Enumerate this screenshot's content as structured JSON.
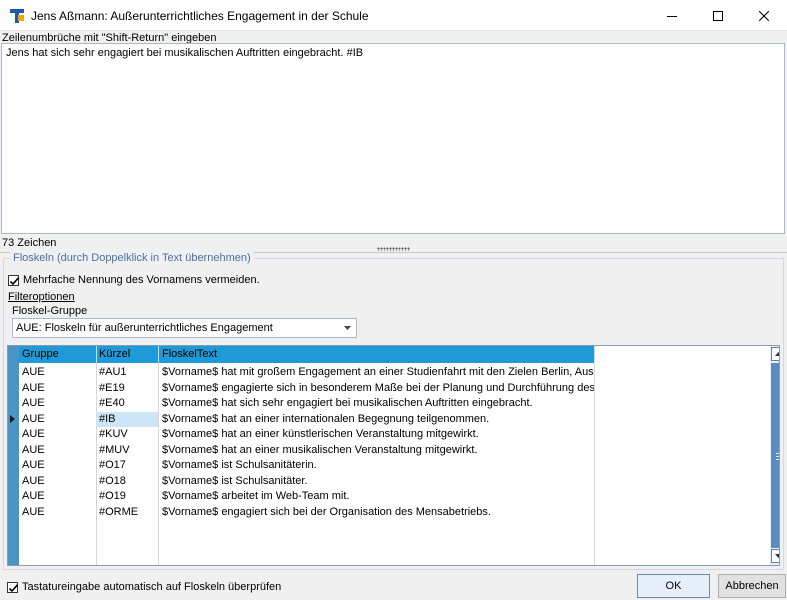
{
  "window": {
    "title": "Jens Aßmann: Außerunterrichtliches Engagement in der Schule",
    "controls": [
      "minimize-icon",
      "maximize-icon",
      "close-icon"
    ]
  },
  "editor": {
    "hint": "Zeilenumbrüche mit \"Shift-Return\" eingeben",
    "text": "Jens hat sich sehr engagiert bei musikalischen Auftritten eingebracht.  #IB",
    "char_count": "73 Zeichen"
  },
  "floskeln": {
    "group_title": "Floskeln (durch Doppelklick in Text übernehmen)",
    "avoid_repeat_label": "Mehrfache Nennung des Vornamens vermeiden.",
    "avoid_repeat_checked": true,
    "filter_link": "Filteroptionen",
    "group_select_label": "Floskel-Gruppe",
    "group_select_value": "AUE: Floskeln für außerunterrichtliches Engagement"
  },
  "grid": {
    "columns": [
      "Gruppe",
      "Kürzel",
      "FloskelText"
    ],
    "selected_row": 3,
    "rows": [
      {
        "gruppe": "AUE",
        "kuerzel": "#AU1",
        "text": "$Vorname$ hat mit großem Engagement an einer Studienfahrt mit den Zielen Berlin, Auschwit"
      },
      {
        "gruppe": "AUE",
        "kuerzel": "#E19",
        "text": "$Vorname$ engagierte sich in besonderem Maße bei der Planung und Durchführung des Weih"
      },
      {
        "gruppe": "AUE",
        "kuerzel": "#E40",
        "text": "$Vorname$ hat sich sehr engagiert bei musikalischen Auftritten eingebracht."
      },
      {
        "gruppe": "AUE",
        "kuerzel": "#IB",
        "text": "$Vorname$ hat an einer internationalen Begegnung teilgenommen."
      },
      {
        "gruppe": "AUE",
        "kuerzel": "#KUV",
        "text": "$Vorname$ hat an einer künstlerischen Veranstaltung mitgewirkt."
      },
      {
        "gruppe": "AUE",
        "kuerzel": "#MUV",
        "text": "$Vorname$ hat an einer musikalischen Veranstaltung mitgewirkt."
      },
      {
        "gruppe": "AUE",
        "kuerzel": "#O17",
        "text": "$Vorname$ ist Schulsanitäterin."
      },
      {
        "gruppe": "AUE",
        "kuerzel": "#O18",
        "text": "$Vorname$ ist Schulsanitäter."
      },
      {
        "gruppe": "AUE",
        "kuerzel": "#O19",
        "text": "$Vorname$ arbeitet im Web-Team mit."
      },
      {
        "gruppe": "AUE",
        "kuerzel": "#ORME",
        "text": "$Vorname$ engagiert sich bei der Organisation des Mensabetriebs."
      }
    ]
  },
  "footer": {
    "auto_check_label": "Tastatureingabe automatisch auf Floskeln überprüfen",
    "auto_check_checked": true,
    "ok_label": "OK",
    "cancel_label": "Abbrechen"
  },
  "colors": {
    "header": "#1f9ad6",
    "row_indicator": "#4a94c8",
    "selection": "#cde6f7",
    "group_title": "#4a6fa5",
    "scroll_thumb": "#5c8cc2"
  }
}
